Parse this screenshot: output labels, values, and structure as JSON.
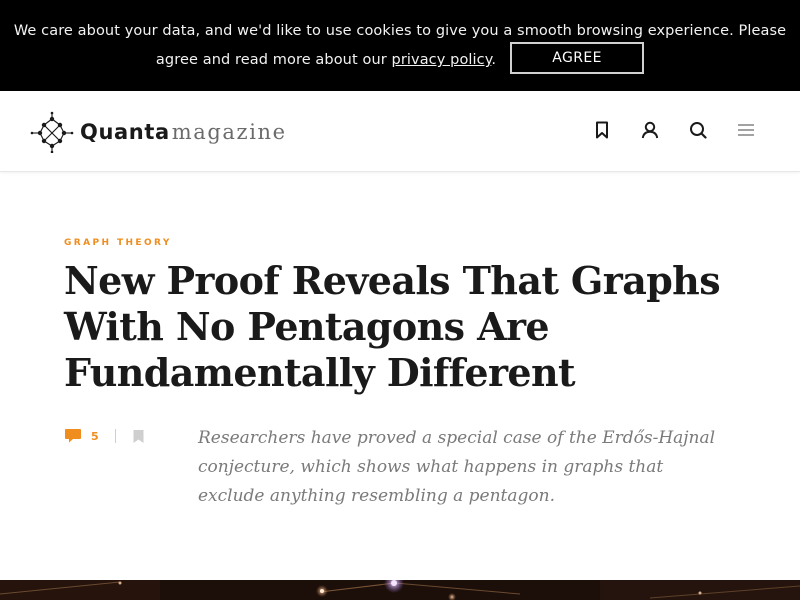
{
  "cookie_banner": {
    "text_before_link": "We care about your data, and we'd like to use cookies to give you a smooth browsing experience. Please agree and read more about our ",
    "link_text": "privacy policy",
    "text_after_link": ".",
    "agree_label": "AGREE"
  },
  "header": {
    "logo_word": "Quanta",
    "logo_suffix": "magazine",
    "icons": [
      "bookmark-icon",
      "user-icon",
      "search-icon",
      "menu-icon"
    ]
  },
  "article": {
    "category": "GRAPH THEORY",
    "headline": "New Proof Reveals That Graphs With No Pentagons Are Fundamentally Different",
    "comment_count": "5",
    "dek": "Researchers have proved a special case of the Erdős-Hajnal conjecture, which shows what happens in graphs that exclude anything resembling a pentagon."
  },
  "colors": {
    "accent": "#ef8d1e",
    "banner_bg": "#000000",
    "text_dark": "#1a1a1a",
    "dek_gray": "#7a7a7a"
  }
}
